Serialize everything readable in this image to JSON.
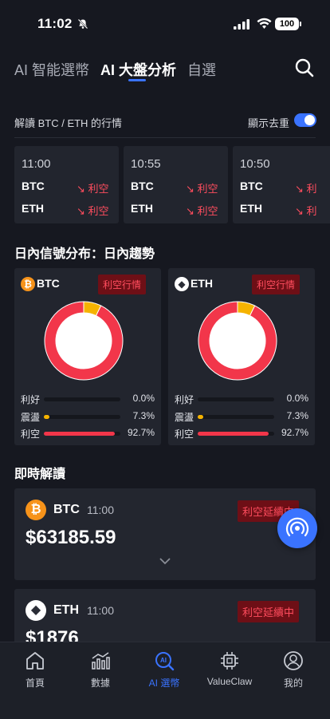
{
  "status": {
    "time": "11:02",
    "battery": "100"
  },
  "tabs": [
    {
      "label": "AI 智能選幣"
    },
    {
      "label": "AI 大盤分析"
    },
    {
      "label": "自選"
    }
  ],
  "filter": {
    "label": "解讀 BTC / ETH 的行情",
    "toggle_label": "顯示去重",
    "toggle_on": true
  },
  "timeline": [
    {
      "time": "11:00",
      "rows": [
        {
          "coin": "BTC",
          "signal": "↘ 利空"
        },
        {
          "coin": "ETH",
          "signal": "↘ 利空"
        }
      ]
    },
    {
      "time": "10:55",
      "rows": [
        {
          "coin": "BTC",
          "signal": "↘ 利空"
        },
        {
          "coin": "ETH",
          "signal": "↘ 利空"
        }
      ]
    },
    {
      "time": "10:50",
      "rows": [
        {
          "coin": "BTC",
          "signal": "↘ 利"
        },
        {
          "coin": "ETH",
          "signal": "↘ 利"
        }
      ]
    }
  ],
  "distribution": {
    "title": "日內信號分布：日內趨勢",
    "cards": [
      {
        "coin": "BTC",
        "icon": "bitcoin-icon",
        "badge": "利空行情",
        "legend": [
          {
            "label": "利好",
            "pct": "0.0%",
            "value": 0.0,
            "color": "#3a73ff"
          },
          {
            "label": "震盪",
            "pct": "7.3%",
            "value": 7.3,
            "color": "#f5b300"
          },
          {
            "label": "利空",
            "pct": "92.7%",
            "value": 92.7,
            "color": "#f2364a"
          }
        ]
      },
      {
        "coin": "ETH",
        "icon": "ethereum-icon",
        "badge": "利空行情",
        "legend": [
          {
            "label": "利好",
            "pct": "0.0%",
            "value": 0.0,
            "color": "#3a73ff"
          },
          {
            "label": "震盪",
            "pct": "7.3%",
            "value": 7.3,
            "color": "#f5b300"
          },
          {
            "label": "利空",
            "pct": "92.7%",
            "value": 92.7,
            "color": "#f2364a"
          }
        ]
      }
    ]
  },
  "live": {
    "title": "即時解讀",
    "cards": [
      {
        "coin": "BTC",
        "time": "11:00",
        "price": "$63185.59",
        "badge": "利空延續中"
      },
      {
        "coin": "ETH",
        "time": "11:00",
        "price": "$1876",
        "badge": "利空延續中"
      }
    ]
  },
  "nav": [
    {
      "label": "首頁",
      "icon": "home-icon"
    },
    {
      "label": "數據",
      "icon": "chart-icon"
    },
    {
      "label": "AI 選幣",
      "icon": "ai-search-icon",
      "active": true
    },
    {
      "label": "ValueClaw",
      "icon": "chip-icon"
    },
    {
      "label": "我的",
      "icon": "profile-icon"
    }
  ],
  "colors": {
    "bg": "#161820",
    "card": "#22252e",
    "accent": "#3a73ff",
    "bearish": "#f2364a",
    "neutral": "#f5b300"
  }
}
